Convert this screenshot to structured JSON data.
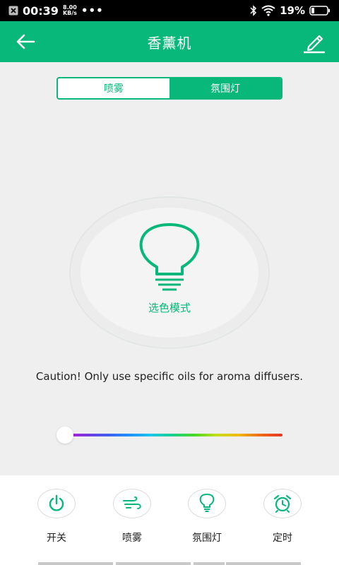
{
  "status_bar": {
    "time": "00:39",
    "net_speed_value": "8.00",
    "net_speed_unit": "KB/s",
    "dots": "•••",
    "battery_percent": "19%"
  },
  "app_bar": {
    "title": "香薰机",
    "back_icon": "arrow-left-icon",
    "edit_icon": "pencil-icon"
  },
  "segments": [
    {
      "label": "喷雾",
      "selected": false
    },
    {
      "label": "氛围灯",
      "selected": true
    }
  ],
  "dial": {
    "icon": "light-bulb-icon",
    "mode_label": "选色模式"
  },
  "caution_text": "Caution! Only use specific oils for aroma diffusers.",
  "color_slider": {
    "value": 0
  },
  "bottom_tabs": [
    {
      "label": "开关",
      "icon": "power-icon"
    },
    {
      "label": "喷雾",
      "icon": "mist-icon"
    },
    {
      "label": "氛围灯",
      "icon": "bulb-icon"
    },
    {
      "label": "定时",
      "icon": "alarm-clock-icon"
    }
  ],
  "colors": {
    "accent": "#08b77a",
    "background": "#efefef"
  }
}
